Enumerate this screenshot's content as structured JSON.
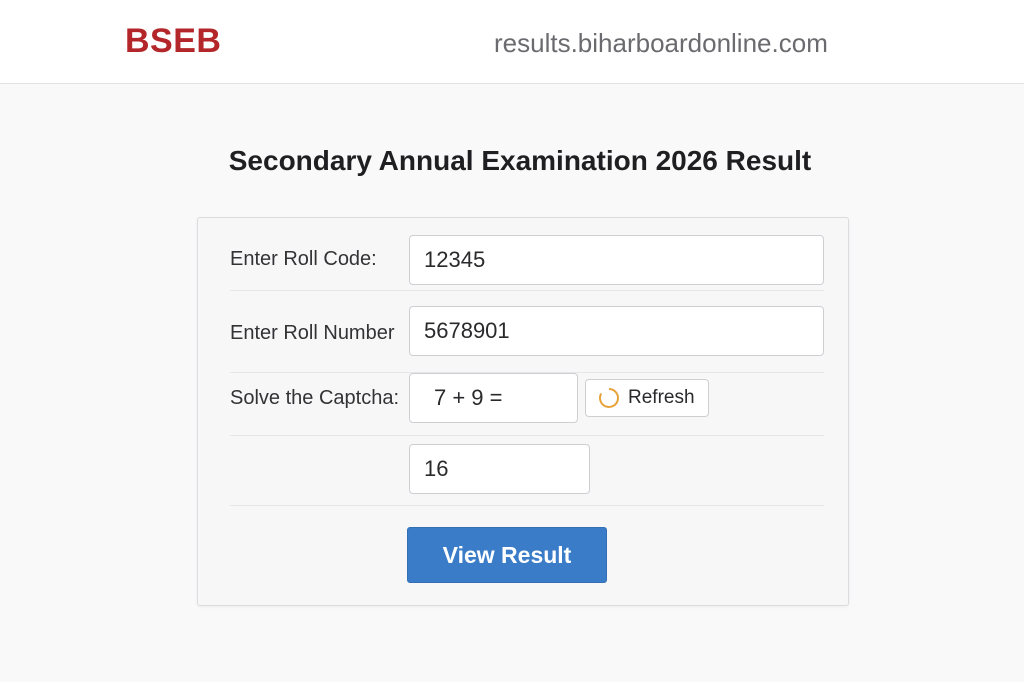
{
  "header": {
    "logo_text": "BSEB",
    "site_url": "results.biharboardonline.com"
  },
  "page": {
    "title": "Secondary Annual Examination 2026 Result"
  },
  "form": {
    "roll_code": {
      "label": "Enter Roll Code:",
      "value": "12345"
    },
    "roll_number": {
      "label": "Enter Roll Number",
      "value": "5678901"
    },
    "captcha": {
      "label": "Solve the Captcha:",
      "question": "7 + 9 =",
      "refresh_label": "Refresh",
      "answer": "16"
    },
    "submit_label": "View Result"
  },
  "colors": {
    "brand_red": "#b3262a",
    "button_blue": "#3a7cc7",
    "refresh_icon": "#e8a23a"
  },
  "icons": {
    "refresh": "refresh-icon"
  }
}
